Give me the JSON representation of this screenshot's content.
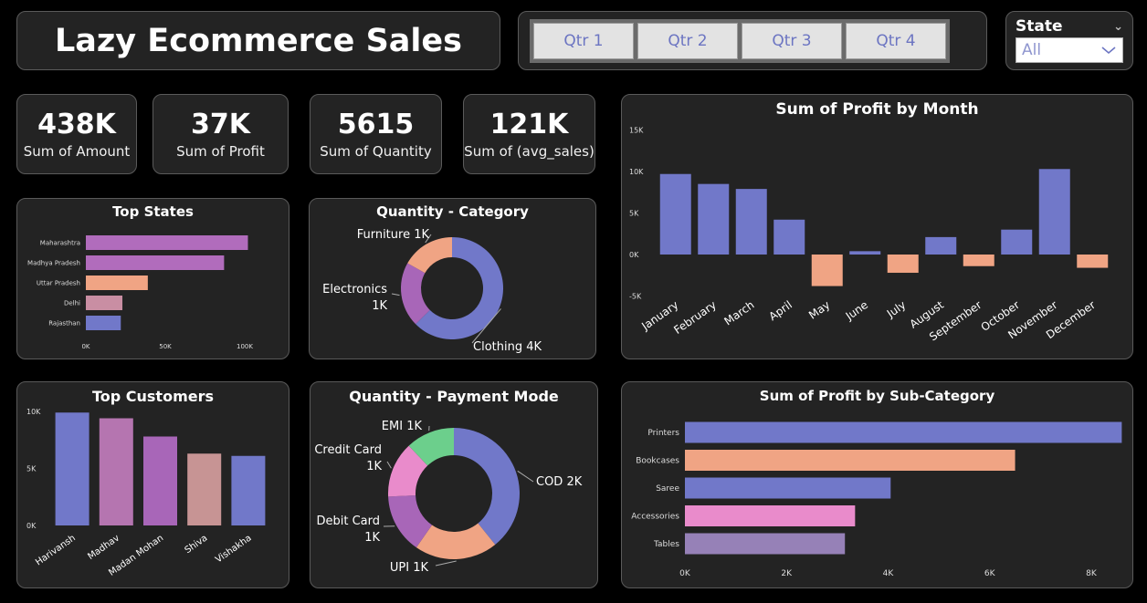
{
  "header": {
    "title": "Lazy Ecommerce Sales"
  },
  "quarters": [
    "Qtr 1",
    "Qtr 2",
    "Qtr 3",
    "Qtr 4"
  ],
  "state_filter": {
    "label": "State",
    "value": "All"
  },
  "kpis": [
    {
      "value": "438K",
      "label": "Sum of Amount"
    },
    {
      "value": "37K",
      "label": "Sum of Profit"
    },
    {
      "value": "5615",
      "label": "Sum of Quantity"
    },
    {
      "value": "121K",
      "label": "Sum of (avg_sales)"
    }
  ],
  "colors": {
    "blue": "#7178c9",
    "salmon": "#f0a484",
    "purple": "#a866b8",
    "pink": "#e98bcb",
    "green": "#6ccf8c",
    "rose": "#c79494"
  },
  "chart_data": [
    {
      "type": "bar",
      "orientation": "horizontal",
      "title": "Top States",
      "categories": [
        "Maharashtra",
        "Madhya Pradesh",
        "Uttar Pradesh",
        "Delhi",
        "Rajasthan"
      ],
      "values": [
        102000,
        87000,
        39000,
        23000,
        22000
      ],
      "colors": [
        "#b16cbc",
        "#b16cbc",
        "#f0a484",
        "#c98ea3",
        "#7178c9"
      ],
      "xticks": [
        "0K",
        "50K",
        "100K"
      ],
      "xlim": [
        0,
        100000
      ]
    },
    {
      "type": "pie",
      "donut": true,
      "title": "Quantity - Category",
      "labels": [
        "Clothing 4K",
        "Electronics 1K",
        "Furniture 1K"
      ],
      "values": [
        3516,
        1154,
        945
      ],
      "colors": [
        "#7178c9",
        "#a866b8",
        "#f0a484"
      ]
    },
    {
      "type": "bar",
      "title": "Sum of Profit by Month",
      "categories": [
        "January",
        "February",
        "March",
        "April",
        "May",
        "June",
        "July",
        "August",
        "September",
        "October",
        "November",
        "December"
      ],
      "values": [
        9700,
        8500,
        7900,
        4200,
        -3800,
        400,
        -2200,
        2100,
        -1400,
        3000,
        10300,
        -1600
      ],
      "yticks": [
        "15K",
        "10K",
        "5K",
        "0K",
        "-5K"
      ],
      "ylim": [
        -5000,
        15000
      ]
    },
    {
      "type": "bar",
      "title": "Top Customers",
      "categories": [
        "Harivansh",
        "Madhav",
        "Madan Mohan",
        "Shiva",
        "Vishakha"
      ],
      "values": [
        9900,
        9400,
        7800,
        6300,
        6100
      ],
      "colors": [
        "#7178c9",
        "#b575b0",
        "#a866b8",
        "#c79494",
        "#7178c9"
      ],
      "yticks": [
        "10K",
        "5K",
        "0K"
      ],
      "ylim": [
        0,
        10000
      ]
    },
    {
      "type": "pie",
      "donut": true,
      "title": "Quantity - Payment Mode",
      "labels": [
        "COD 2K",
        "UPI 1K",
        "Debit Card 1K",
        "Credit Card 1K",
        "EMI 1K"
      ],
      "values": [
        2200,
        1150,
        820,
        770,
        675
      ],
      "colors": [
        "#7178c9",
        "#f0a484",
        "#a866b8",
        "#e98bcb",
        "#6ccf8c"
      ]
    },
    {
      "type": "bar",
      "orientation": "horizontal",
      "title": "Sum of Profit by Sub-Category",
      "categories": [
        "Printers",
        "Bookcases",
        "Saree",
        "Accessories",
        "Tables"
      ],
      "values": [
        8600,
        6500,
        4050,
        3350,
        3150
      ],
      "colors": [
        "#7178c9",
        "#f0a484",
        "#7178c9",
        "#e98bcb",
        "#9681b7"
      ],
      "xticks": [
        "0K",
        "2K",
        "4K",
        "6K",
        "8K"
      ],
      "xlim": [
        0,
        8000
      ]
    }
  ]
}
